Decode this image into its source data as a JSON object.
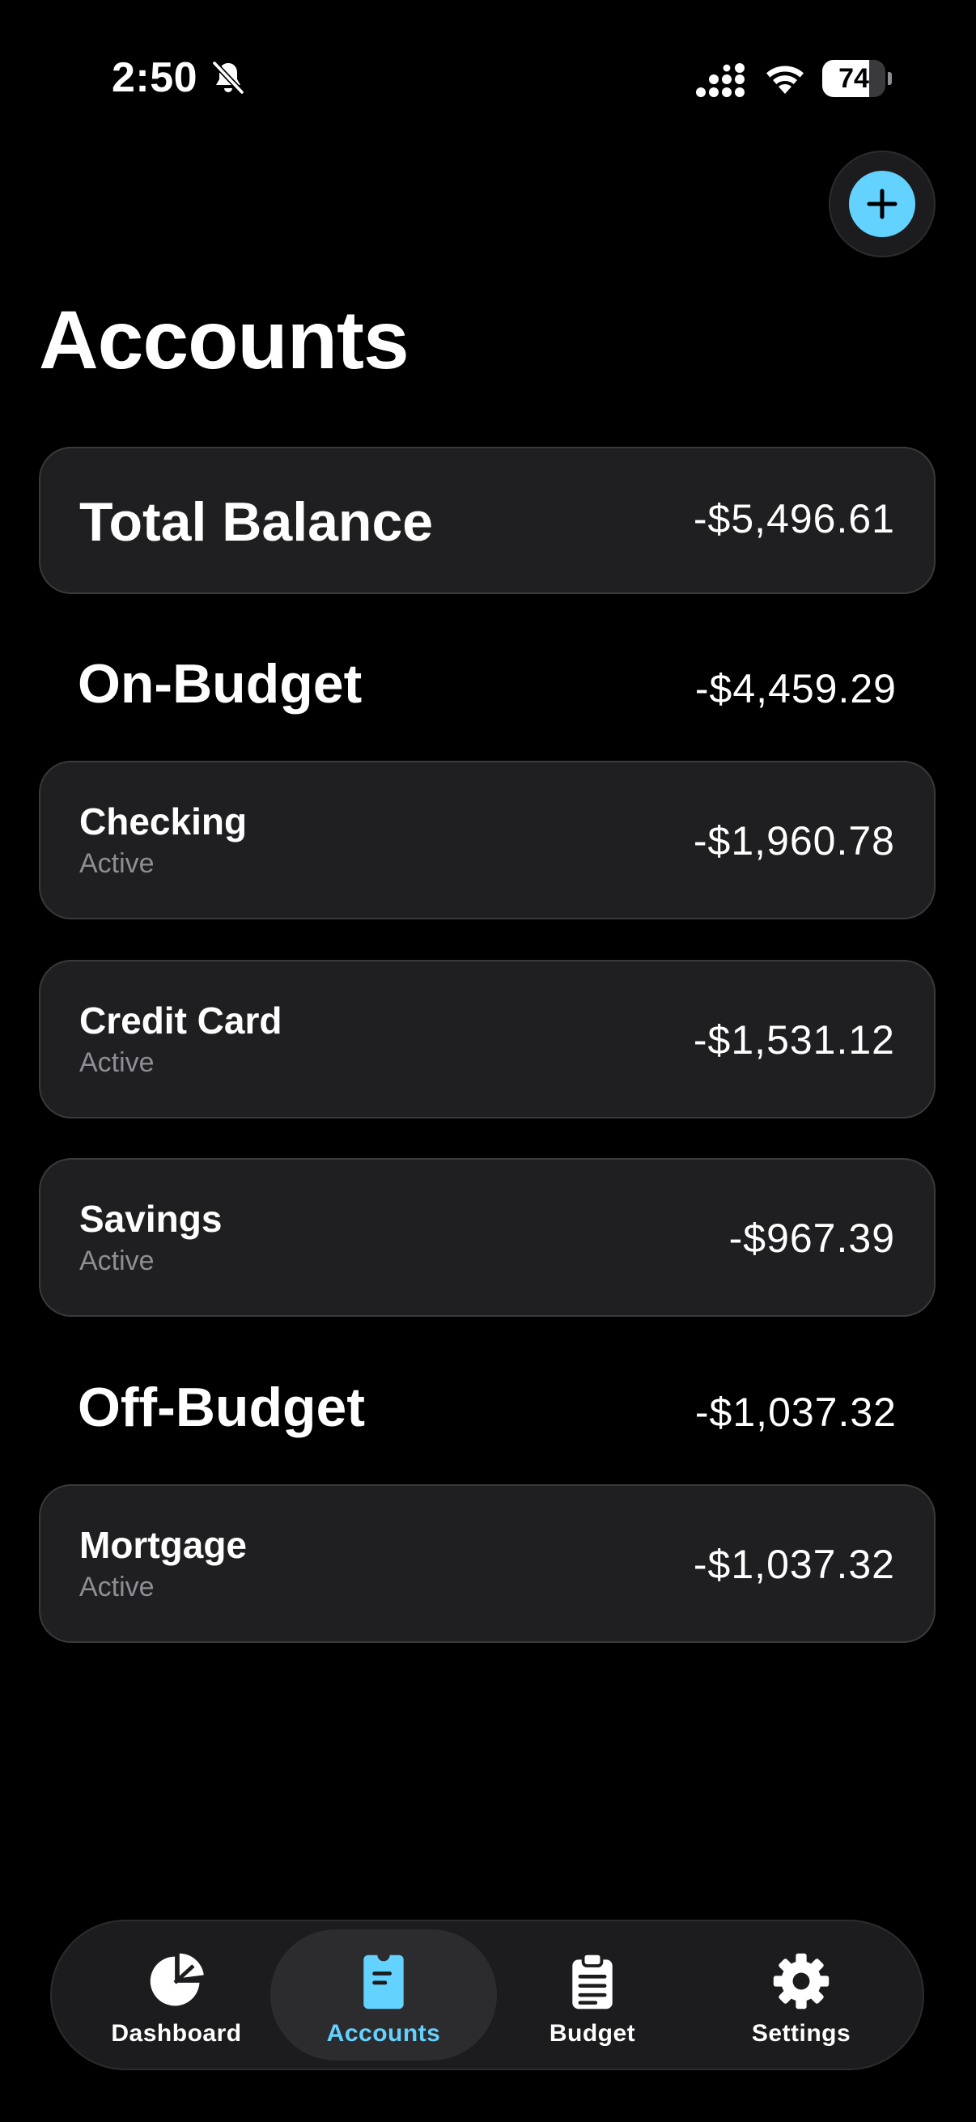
{
  "status_bar": {
    "time": "2:50",
    "battery": "74",
    "battery_level": 0.74,
    "icons": [
      "bell-slash-icon",
      "signal-icon",
      "wifi-icon",
      "battery-icon"
    ]
  },
  "header": {
    "title": "Accounts",
    "add_icon": "plus-icon"
  },
  "total": {
    "label": "Total Balance",
    "amount": "-$5,496.61"
  },
  "on_budget": {
    "title": "On-Budget",
    "amount": "-$4,459.29",
    "accounts": [
      {
        "name": "Checking",
        "status": "Active",
        "amount": "-$1,960.78"
      },
      {
        "name": "Credit Card",
        "status": "Active",
        "amount": "-$1,531.12"
      },
      {
        "name": "Savings",
        "status": "Active",
        "amount": "-$967.39"
      }
    ]
  },
  "off_budget": {
    "title": "Off-Budget",
    "amount": "-$1,037.32",
    "accounts": [
      {
        "name": "Mortgage",
        "status": "Active",
        "amount": "-$1,037.32"
      }
    ]
  },
  "tabs": [
    {
      "label": "Dashboard",
      "icon": "pie-chart-icon",
      "active": false
    },
    {
      "label": "Accounts",
      "icon": "card-icon",
      "active": true
    },
    {
      "label": "Budget",
      "icon": "clipboard-icon",
      "active": false
    },
    {
      "label": "Settings",
      "icon": "gear-icon",
      "active": false
    }
  ],
  "colors": {
    "accent": "#64d2ff",
    "background": "#000000",
    "card": "#1f1f21",
    "secondary_text": "#8e8e93"
  }
}
